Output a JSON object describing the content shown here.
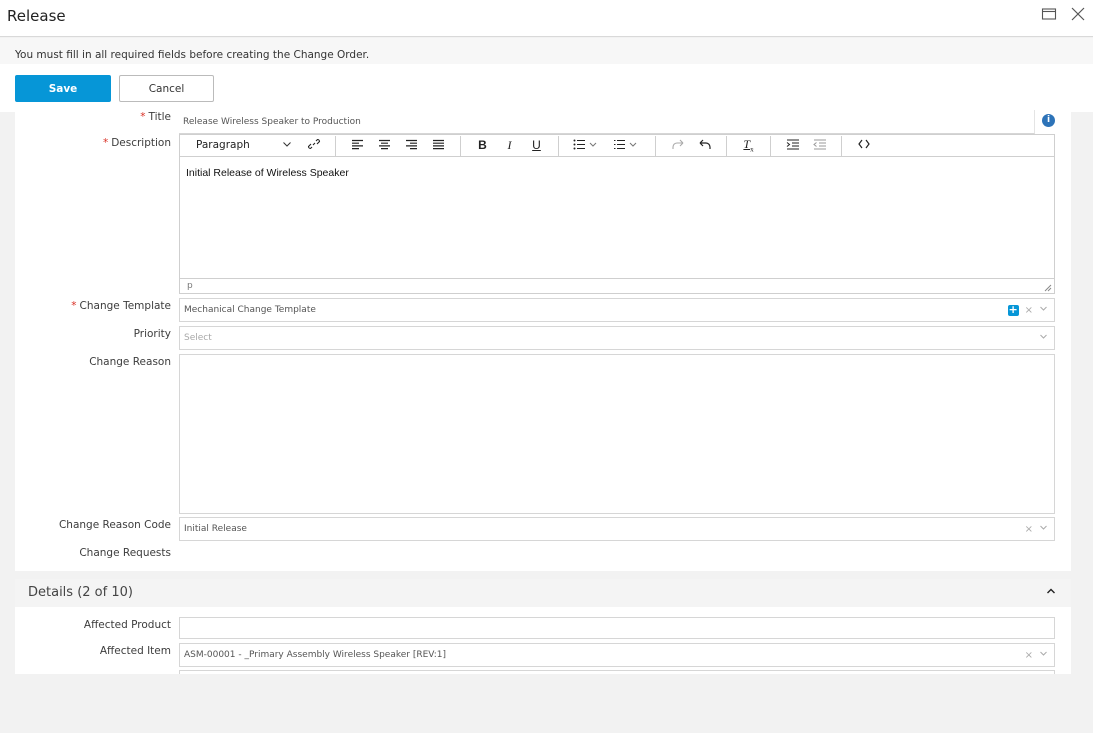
{
  "window": {
    "title": "Release",
    "maximize_icon": "window-maximize-icon",
    "close_icon": "close-icon"
  },
  "notice": "You must fill in all required fields before creating the Change Order.",
  "actions": {
    "save_label": "Save",
    "cancel_label": "Cancel"
  },
  "form": {
    "title": {
      "label": "Title",
      "required": "*",
      "value": "Release Wireless Speaker to Production"
    },
    "description": {
      "label": "Description",
      "required": "*",
      "format_select": "Paragraph",
      "content": "Initial Release of Wireless Speaker",
      "status_path": "p"
    },
    "change_template": {
      "label": "Change Template",
      "required": "*",
      "value": "Mechanical Change Template",
      "add_icon": "+"
    },
    "priority": {
      "label": "Priority",
      "placeholder": "Select"
    },
    "change_reason": {
      "label": "Change Reason",
      "value": ""
    },
    "change_reason_code": {
      "label": "Change Reason Code",
      "value": "Initial Release"
    },
    "change_requests": {
      "label": "Change Requests"
    }
  },
  "details": {
    "title": "Details (2 of 10)",
    "affected_product": {
      "label": "Affected Product",
      "value": ""
    },
    "affected_item": {
      "label": "Affected Item",
      "value": "ASM-00001 - _Primary Assembly Wireless Speaker [REV:1]"
    }
  },
  "glyphs": {
    "clear": "×",
    "chevron_down": "⌵",
    "info": "i",
    "chevron_up": "^"
  },
  "colors": {
    "primary": "#0696d7",
    "required": "#d93025",
    "info": "#2d73b8"
  }
}
